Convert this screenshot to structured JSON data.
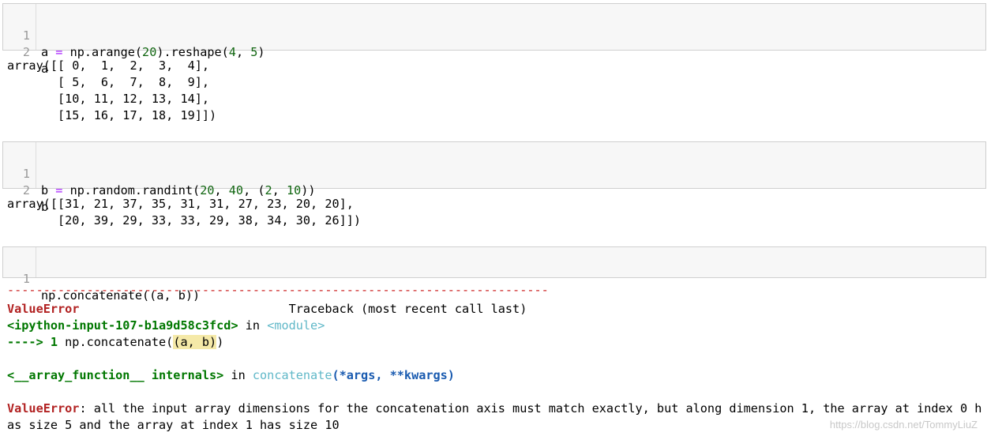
{
  "cells": [
    {
      "input": {
        "line_numbers": [
          "1",
          "2"
        ],
        "line1": {
          "p1": "a ",
          "op": "=",
          "p2": " np.arange(",
          "n1": "20",
          "p3": ").reshape(",
          "n2": "4",
          "p4": ", ",
          "n3": "5",
          "p5": ")"
        },
        "line2": "a"
      },
      "output": [
        "array([[ 0,  1,  2,  3,  4],",
        "       [ 5,  6,  7,  8,  9],",
        "       [10, 11, 12, 13, 14],",
        "       [15, 16, 17, 18, 19]])"
      ]
    },
    {
      "input": {
        "line_numbers": [
          "1",
          "2"
        ],
        "line1": {
          "p1": "b ",
          "op": "=",
          "p2": " np.random.randint(",
          "n1": "20",
          "p3": ", ",
          "n2": "40",
          "p4": ", (",
          "n3": "2",
          "p5": ", ",
          "n4": "10",
          "p6": "))"
        },
        "line2": "b"
      },
      "output": [
        "array([[31, 21, 37, 35, 31, 31, 27, 23, 20, 20],",
        "       [20, 39, 29, 33, 33, 29, 38, 34, 30, 26]])"
      ]
    },
    {
      "input": {
        "line_numbers": [
          "1"
        ],
        "line1": "np.concatenate((a, b))"
      },
      "error": {
        "separator": "---------------------------------------------------------------------------",
        "error_name": "ValueError",
        "traceback_label": "                             Traceback (most recent call last)",
        "input_ref": "<ipython-input-107-b1a9d58c3fcd>",
        "in_word": " in ",
        "module": "<module>",
        "arrow": "----> 1",
        "arrow_code_1": " np.concatenate(",
        "arrow_code_2": "(a, b)",
        "arrow_code_3": ")",
        "internals": "<__array_function__ internals>",
        "in_word2": " in ",
        "func": "concatenate",
        "args": "(*args, **kwargs)",
        "final_name": "ValueError",
        "final_msg_1": ": all the input array dimensions for the concatenation axis must match exactly, but along dimension 1, the array at index 0 h",
        "final_msg_2": "as size 5 and the array at index 1 has size 10"
      }
    }
  ],
  "watermark": "https://blog.csdn.net/TommyLiuZ"
}
